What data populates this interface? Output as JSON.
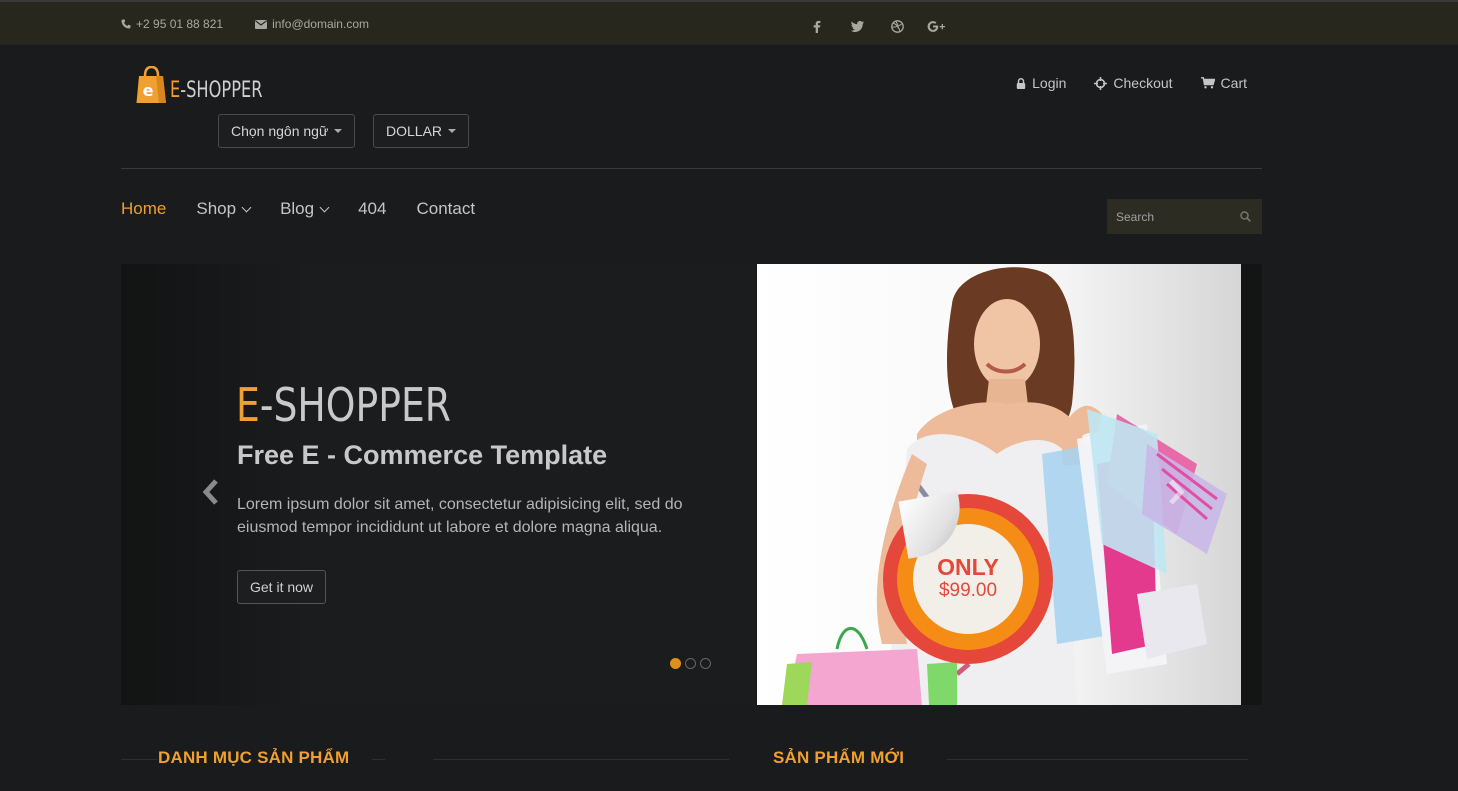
{
  "topbar": {
    "phone": "+2 95 01 88 821",
    "email": "info@domain.com",
    "social": [
      "facebook-icon",
      "twitter-icon",
      "dribbble-icon",
      "google-plus-icon"
    ]
  },
  "logo": {
    "e": "E",
    "rest": "-SHOPPER",
    "badge_letter": "e"
  },
  "language_select": {
    "label": "Chọn ngôn ngữ"
  },
  "currency_select": {
    "label": "DOLLAR"
  },
  "shop_menu": {
    "login": "Login",
    "checkout": "Checkout",
    "cart": "Cart"
  },
  "nav": {
    "home": "Home",
    "shop": "Shop",
    "blog": "Blog",
    "notfound": "404",
    "contact": "Contact"
  },
  "search": {
    "placeholder": "Search"
  },
  "slider": {
    "brand_e": "E",
    "brand_rest": "-SHOPPER",
    "tagline": "Free E - Commerce Template",
    "description": "Lorem ipsum dolor sit amet, consectetur adipisicing elit, sed do eiusmod tempor incididunt ut labore et dolore magna aliqua.",
    "cta": "Get it now",
    "badge_only": "ONLY",
    "badge_price": "$99.00",
    "active_slide": 1,
    "slide_count": 3
  },
  "sections": {
    "categories": "DANH MỤC SẢN PHẨM",
    "new_products": "SẢN PHẨM MỚI"
  },
  "colors": {
    "accent": "#f0a030",
    "background": "#1a1b1d",
    "topbar": "#28271d"
  }
}
